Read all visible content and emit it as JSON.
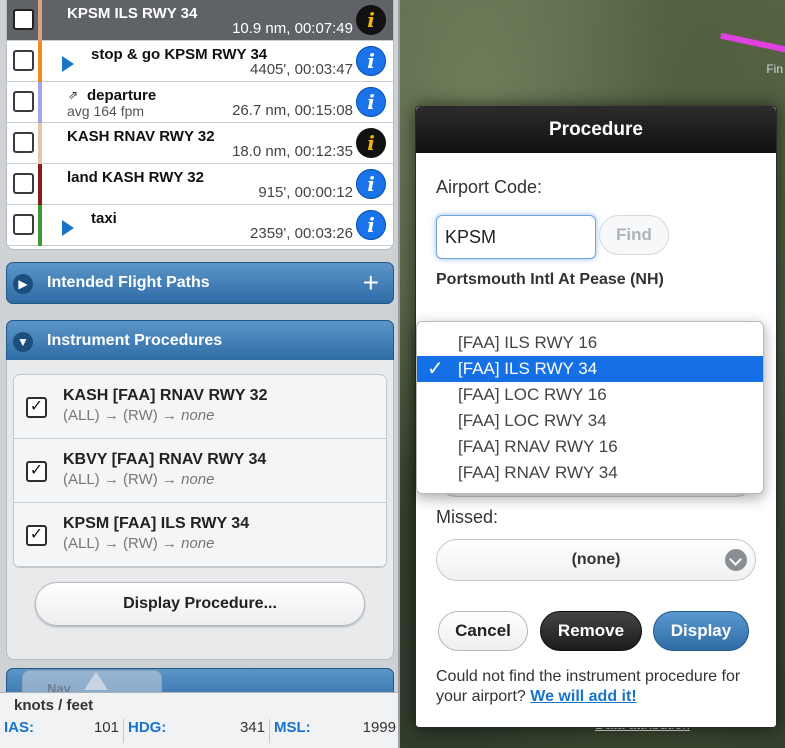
{
  "legs": [
    {
      "title": "KPSM ILS RWY 34",
      "sub": "",
      "detail": "10.9 nm, 00:07:49",
      "color": "#d9a27a",
      "active": true,
      "info": "black",
      "marker": ""
    },
    {
      "title": "stop & go KPSM RWY 34",
      "sub": "",
      "detail": "4405', 00:03:47",
      "color": "#f28c1c",
      "active": false,
      "info": "blue",
      "marker": "triangle"
    },
    {
      "title": "departure",
      "sub": "avg 164 fpm",
      "detail": "26.7 nm, 00:15:08",
      "color": "#9fa6f0",
      "active": false,
      "info": "blue",
      "marker": "arrow"
    },
    {
      "title": "KASH RNAV RWY 32",
      "sub": "",
      "detail": "18.0 nm, 00:12:35",
      "color": "#e8c2a8",
      "active": false,
      "info": "black",
      "marker": ""
    },
    {
      "title": "land KASH RWY 32",
      "sub": "",
      "detail": "915', 00:00:12",
      "color": "#8b1a1a",
      "active": false,
      "info": "blue",
      "marker": ""
    },
    {
      "title": "taxi",
      "sub": "",
      "detail": "2359', 00:03:26",
      "color": "#3a9a3a",
      "active": false,
      "info": "blue",
      "marker": "triangle"
    }
  ],
  "info_glyph": "i",
  "arrow_glyph": "⇗",
  "intended": {
    "label": "Intended Flight Paths",
    "plus": "+"
  },
  "instrument": {
    "label": "Instrument Procedures"
  },
  "procedures": [
    {
      "title": "KASH [FAA] RNAV RWY 32",
      "route": "(ALL) → (RW) → ",
      "none": "none"
    },
    {
      "title": "KBVY [FAA] RNAV RWY 34",
      "route": "(ALL) → (RW) → ",
      "none": "none"
    },
    {
      "title": "KPSM [FAA] ILS RWY 34",
      "route": "(ALL) → (RW) → ",
      "none": "none"
    }
  ],
  "check_glyph": "✓",
  "display_procedure": "Display Procedure...",
  "nav_label": "Nav",
  "status": {
    "units": "knots / feet",
    "ias_label": "IAS:",
    "ias_value": "101",
    "hdg_label": "HDG:",
    "hdg_value": "341",
    "msl_label": "MSL:",
    "msl_value": "1999"
  },
  "map": {
    "attribution": "Data attribution",
    "label": "Fin"
  },
  "dialog": {
    "title": "Procedure",
    "airport_code_label": "Airport Code:",
    "airport_code_value": "KPSM",
    "find": "Find",
    "airport_name": "Portsmouth Intl At Pease (NH)",
    "missed_label": "Missed:",
    "missed_value": "(none)",
    "cancel": "Cancel",
    "remove": "Remove",
    "display": "Display",
    "note": "Could not find the instrument procedure for your airport? ",
    "note_link": "We will add it!"
  },
  "dropdown": {
    "options": [
      "[FAA] ILS RWY 16",
      "[FAA] ILS RWY 34",
      "[FAA] LOC RWY 16",
      "[FAA] LOC RWY 34",
      "[FAA] RNAV RWY 16",
      "[FAA] RNAV RWY 34"
    ],
    "selected_index": 1,
    "check": "✓"
  }
}
